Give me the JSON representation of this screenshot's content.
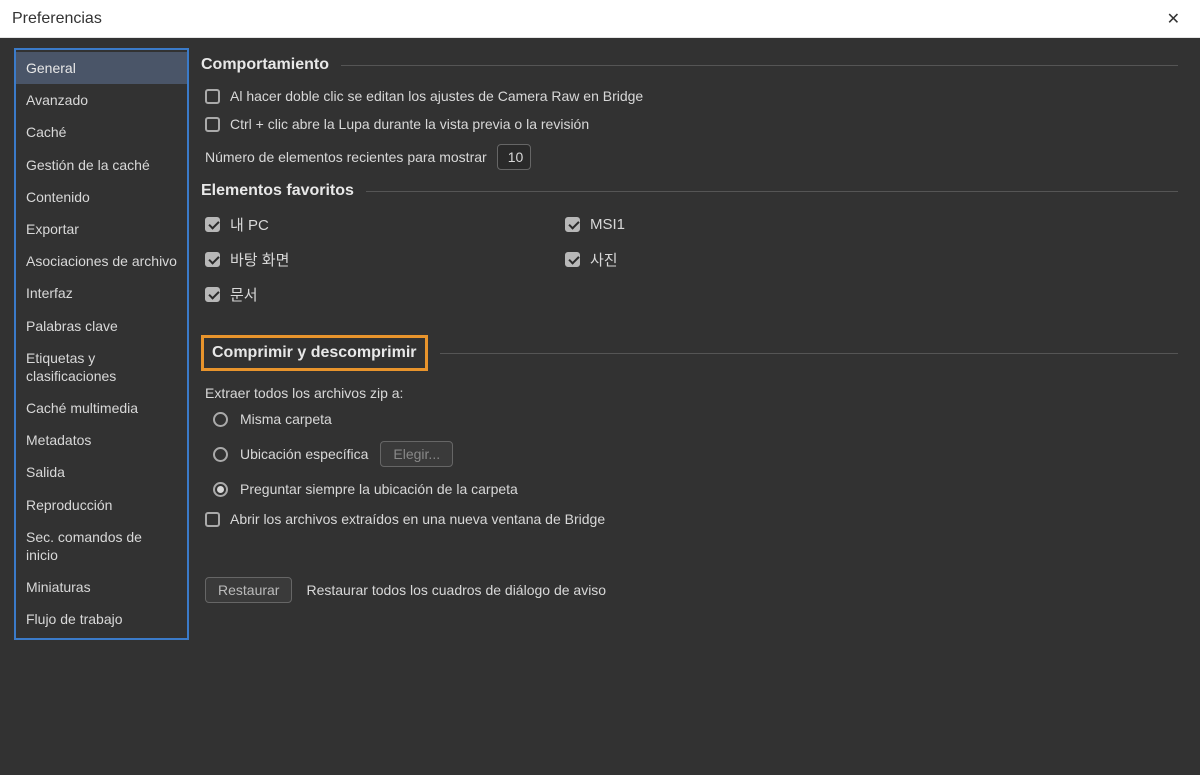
{
  "window": {
    "title": "Preferencias"
  },
  "sidebar": {
    "items": [
      "General",
      "Avanzado",
      "Caché",
      "Gestión de la caché",
      "Contenido",
      "Exportar",
      "Asociaciones de archivo",
      "Interfaz",
      "Palabras clave",
      "Etiquetas y clasificaciones",
      "Caché multimedia",
      "Metadatos",
      "Salida",
      "Reproducción",
      "Sec. comandos de inicio",
      "Miniaturas",
      "Flujo de trabajo"
    ],
    "active_index": 0
  },
  "sections": {
    "behavior": {
      "title": "Comportamiento",
      "opt_doubleclick": "Al hacer doble clic se editan los ajustes de Camera Raw en Bridge",
      "opt_ctrlclick": "Ctrl + clic abre la Lupa durante la vista previa o la revisión",
      "recent_label": "Número de elementos recientes para mostrar",
      "recent_value": "10"
    },
    "favorites": {
      "title": "Elementos favoritos",
      "items": [
        {
          "label": "내 PC",
          "checked": true
        },
        {
          "label": "MSI1",
          "checked": true
        },
        {
          "label": "바탕 화면",
          "checked": true
        },
        {
          "label": "사진",
          "checked": true
        },
        {
          "label": "문서",
          "checked": true
        }
      ]
    },
    "zip": {
      "title": "Comprimir y descomprimir",
      "extract_label": "Extraer todos los archivos zip a:",
      "opt_same": "Misma carpeta",
      "opt_specific": "Ubicación específica",
      "choose_btn": "Elegir...",
      "opt_ask": "Preguntar siempre la ubicación de la carpeta",
      "opt_open_new": "Abrir los archivos extraídos en una nueva ventana de Bridge",
      "selected": "ask"
    },
    "restore": {
      "button": "Restaurar",
      "label": "Restaurar todos los cuadros de diálogo de aviso"
    }
  }
}
